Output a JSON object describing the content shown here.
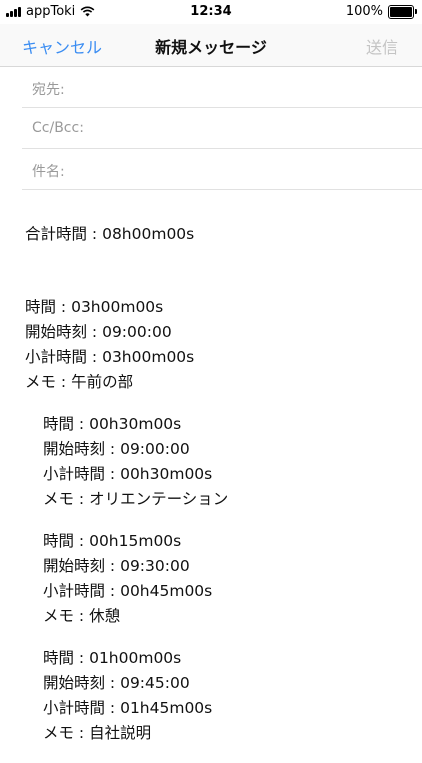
{
  "status_bar": {
    "carrier": "appToki",
    "time": "12:34",
    "battery": "100%"
  },
  "nav": {
    "cancel": "キャンセル",
    "title": "新規メッセージ",
    "send": "送信"
  },
  "fields": {
    "to": "宛先:",
    "cc_bcc": "Cc/Bcc:",
    "subject": "件名:"
  },
  "body": {
    "total": "合計時間 : 08h00m00s",
    "groups": [
      {
        "time": "時間 : 03h00m00s",
        "start": "開始時刻 : 09:00:00",
        "subtotal": "小計時間 : 03h00m00s",
        "memo": "メモ : 午前の部"
      },
      {
        "time": "時間 : 00h30m00s",
        "start": "開始時刻 : 09:00:00",
        "subtotal": "小計時間 : 00h30m00s",
        "memo": "メモ : オリエンテーション"
      },
      {
        "time": "時間 : 00h15m00s",
        "start": "開始時刻 : 09:30:00",
        "subtotal": "小計時間 : 00h45m00s",
        "memo": "メモ : 休憩"
      },
      {
        "time": "時間 : 01h00m00s",
        "start": "開始時刻 : 09:45:00",
        "subtotal": "小計時間 : 01h45m00s",
        "memo": "メモ : 自社説明"
      }
    ]
  },
  "icons": {
    "signal": "signal-icon",
    "wifi": "wifi-icon",
    "battery": "battery-icon"
  },
  "colors": {
    "accent": "#3b8df2",
    "disabled": "#c4c4c4",
    "placeholder": "#9a9a9a"
  }
}
